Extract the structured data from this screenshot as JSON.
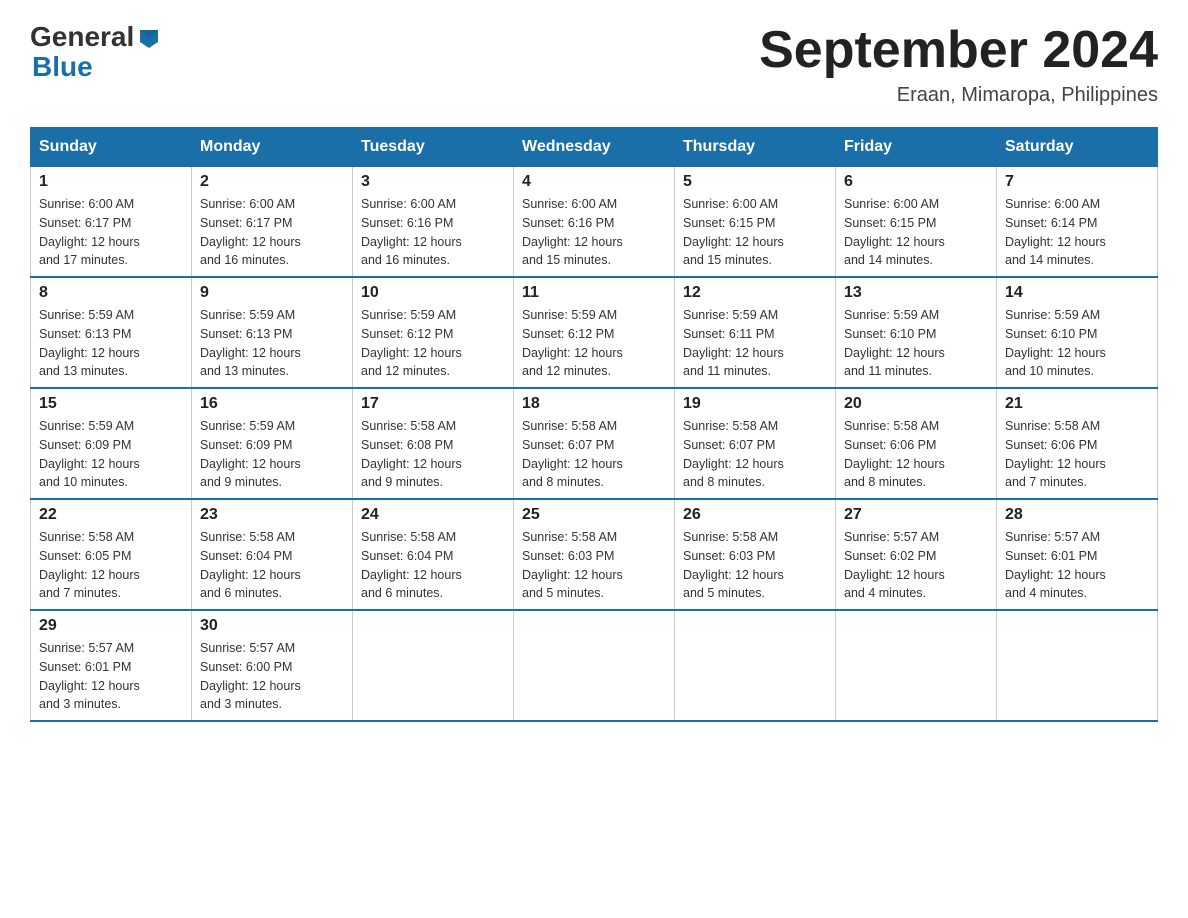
{
  "header": {
    "logo_general": "General",
    "logo_blue": "Blue",
    "title": "September 2024",
    "subtitle": "Eraan, Mimaropa, Philippines"
  },
  "days_of_week": [
    "Sunday",
    "Monday",
    "Tuesday",
    "Wednesday",
    "Thursday",
    "Friday",
    "Saturday"
  ],
  "weeks": [
    [
      {
        "day": "1",
        "sunrise": "6:00 AM",
        "sunset": "6:17 PM",
        "daylight": "12 hours and 17 minutes."
      },
      {
        "day": "2",
        "sunrise": "6:00 AM",
        "sunset": "6:17 PM",
        "daylight": "12 hours and 16 minutes."
      },
      {
        "day": "3",
        "sunrise": "6:00 AM",
        "sunset": "6:16 PM",
        "daylight": "12 hours and 16 minutes."
      },
      {
        "day": "4",
        "sunrise": "6:00 AM",
        "sunset": "6:16 PM",
        "daylight": "12 hours and 15 minutes."
      },
      {
        "day": "5",
        "sunrise": "6:00 AM",
        "sunset": "6:15 PM",
        "daylight": "12 hours and 15 minutes."
      },
      {
        "day": "6",
        "sunrise": "6:00 AM",
        "sunset": "6:15 PM",
        "daylight": "12 hours and 14 minutes."
      },
      {
        "day": "7",
        "sunrise": "6:00 AM",
        "sunset": "6:14 PM",
        "daylight": "12 hours and 14 minutes."
      }
    ],
    [
      {
        "day": "8",
        "sunrise": "5:59 AM",
        "sunset": "6:13 PM",
        "daylight": "12 hours and 13 minutes."
      },
      {
        "day": "9",
        "sunrise": "5:59 AM",
        "sunset": "6:13 PM",
        "daylight": "12 hours and 13 minutes."
      },
      {
        "day": "10",
        "sunrise": "5:59 AM",
        "sunset": "6:12 PM",
        "daylight": "12 hours and 12 minutes."
      },
      {
        "day": "11",
        "sunrise": "5:59 AM",
        "sunset": "6:12 PM",
        "daylight": "12 hours and 12 minutes."
      },
      {
        "day": "12",
        "sunrise": "5:59 AM",
        "sunset": "6:11 PM",
        "daylight": "12 hours and 11 minutes."
      },
      {
        "day": "13",
        "sunrise": "5:59 AM",
        "sunset": "6:10 PM",
        "daylight": "12 hours and 11 minutes."
      },
      {
        "day": "14",
        "sunrise": "5:59 AM",
        "sunset": "6:10 PM",
        "daylight": "12 hours and 10 minutes."
      }
    ],
    [
      {
        "day": "15",
        "sunrise": "5:59 AM",
        "sunset": "6:09 PM",
        "daylight": "12 hours and 10 minutes."
      },
      {
        "day": "16",
        "sunrise": "5:59 AM",
        "sunset": "6:09 PM",
        "daylight": "12 hours and 9 minutes."
      },
      {
        "day": "17",
        "sunrise": "5:58 AM",
        "sunset": "6:08 PM",
        "daylight": "12 hours and 9 minutes."
      },
      {
        "day": "18",
        "sunrise": "5:58 AM",
        "sunset": "6:07 PM",
        "daylight": "12 hours and 8 minutes."
      },
      {
        "day": "19",
        "sunrise": "5:58 AM",
        "sunset": "6:07 PM",
        "daylight": "12 hours and 8 minutes."
      },
      {
        "day": "20",
        "sunrise": "5:58 AM",
        "sunset": "6:06 PM",
        "daylight": "12 hours and 8 minutes."
      },
      {
        "day": "21",
        "sunrise": "5:58 AM",
        "sunset": "6:06 PM",
        "daylight": "12 hours and 7 minutes."
      }
    ],
    [
      {
        "day": "22",
        "sunrise": "5:58 AM",
        "sunset": "6:05 PM",
        "daylight": "12 hours and 7 minutes."
      },
      {
        "day": "23",
        "sunrise": "5:58 AM",
        "sunset": "6:04 PM",
        "daylight": "12 hours and 6 minutes."
      },
      {
        "day": "24",
        "sunrise": "5:58 AM",
        "sunset": "6:04 PM",
        "daylight": "12 hours and 6 minutes."
      },
      {
        "day": "25",
        "sunrise": "5:58 AM",
        "sunset": "6:03 PM",
        "daylight": "12 hours and 5 minutes."
      },
      {
        "day": "26",
        "sunrise": "5:58 AM",
        "sunset": "6:03 PM",
        "daylight": "12 hours and 5 minutes."
      },
      {
        "day": "27",
        "sunrise": "5:57 AM",
        "sunset": "6:02 PM",
        "daylight": "12 hours and 4 minutes."
      },
      {
        "day": "28",
        "sunrise": "5:57 AM",
        "sunset": "6:01 PM",
        "daylight": "12 hours and 4 minutes."
      }
    ],
    [
      {
        "day": "29",
        "sunrise": "5:57 AM",
        "sunset": "6:01 PM",
        "daylight": "12 hours and 3 minutes."
      },
      {
        "day": "30",
        "sunrise": "5:57 AM",
        "sunset": "6:00 PM",
        "daylight": "12 hours and 3 minutes."
      },
      null,
      null,
      null,
      null,
      null
    ]
  ],
  "labels": {
    "sunrise": "Sunrise:",
    "sunset": "Sunset:",
    "daylight": "Daylight:"
  }
}
